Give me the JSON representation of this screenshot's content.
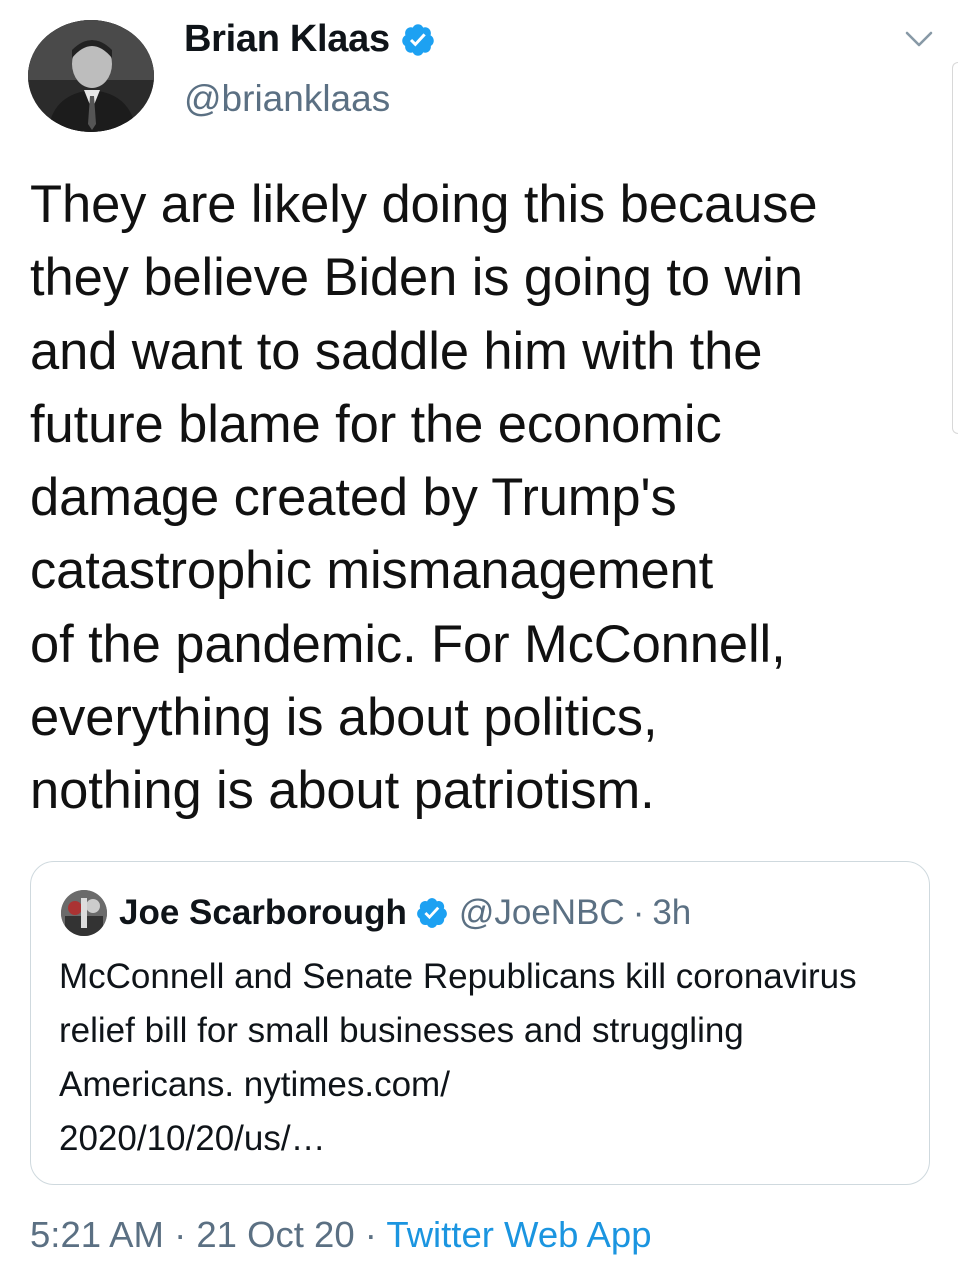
{
  "author": {
    "name": "Brian Klaas",
    "handle": "@brianklaas",
    "verified": true
  },
  "tweet": {
    "text": "They are likely doing this because\nthey believe Biden is going to win\nand want to saddle him with the\nfuture blame for the economic\ndamage created by Trump's\ncatastrophic mismanagement\nof the pandemic. For McConnell,\neverything is about politics,\nnothing is about patriotism."
  },
  "quoted": {
    "name": "Joe Scarborough",
    "handle": "@JoeNBC",
    "separator": "·",
    "time": "3h",
    "text": "McConnell and Senate Republicans kill coronavirus relief bill for small businesses and struggling Americans.  nytimes.com/\n2020/10/20/us/…"
  },
  "meta": {
    "time": "5:21 AM",
    "sep1": " · ",
    "date": "21 Oct 20",
    "sep2": " · ",
    "source": "Twitter Web App"
  },
  "colors": {
    "verified": "#1da1f2",
    "secondary_text": "#5b7083",
    "link": "#1b95e0",
    "border": "#cfd9de"
  },
  "icons": [
    "verified-badge-icon",
    "chevron-down-icon"
  ]
}
